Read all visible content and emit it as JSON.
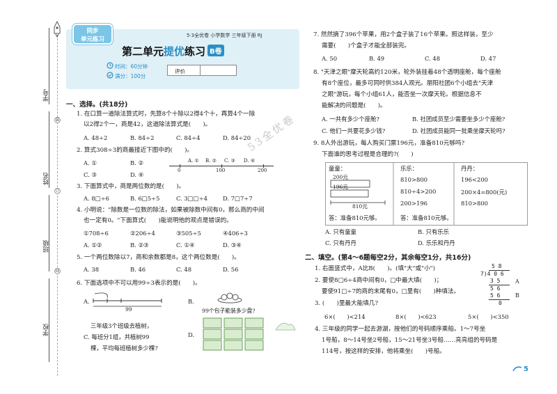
{
  "binding": {
    "labels": [
      "学号",
      "姓名",
      "班级",
      "学校"
    ],
    "hole_labels": [
      "装",
      "订",
      "线"
    ]
  },
  "header": {
    "badge_line1": "同步",
    "badge_line2": "单元练习",
    "book_info": "5·3全优卷  小学数学  三年级下册  RJ",
    "title_part1": "第二单元",
    "title_part2": "提优",
    "title_part3": "练习",
    "title_badge": "B卷",
    "time": "时间：60分钟",
    "full_score": "满分：100分",
    "score_label": "评价"
  },
  "watermark": "53全优卷",
  "section1": {
    "title": "一、选择。(共18分)",
    "q1": {
      "line1": "1. 在口算一道除法算式时，先算8个十除以2得4个十，再算4个一除",
      "line2": "以2得2个一，商是42，这道除法算式是(　　)。",
      "options": [
        "A. 48÷2",
        "B. 84÷2",
        "C. 84÷4",
        "D. 84÷20"
      ]
    },
    "q2": {
      "line1": "2. 算式308÷3的商最接近下图中的(　　)。",
      "options": [
        "A. ①",
        "B. ②",
        "C. ③",
        "D. ④"
      ],
      "numline_labels": [
        "0",
        "100",
        "200"
      ]
    },
    "q3": {
      "line1": "3. 下面算式中，商是两位数的是(　　)。",
      "options": [
        "A. 8□÷6",
        "B. 6□5÷5",
        "C. 3□□÷4",
        "D. 7□7÷7"
      ]
    },
    "q4": {
      "line1": "4. 小明说：\"除数是一位数的除法，如果被除数中间有0，那么商的中间",
      "line2": "也一定有0。\"下面算式(　　)能说明他的观点是错误的。",
      "options": [
        "①708÷6",
        "②206÷4",
        "③505÷5",
        "④406÷3"
      ],
      "choices": [
        "A. ①②",
        "B. ②③",
        "C. ①④",
        "D. ③④"
      ]
    },
    "q5": {
      "line1": "5. 一个两位数除以7，商和余数都是8，这个两位数是(　　)。",
      "options": [
        "A. 38",
        "B. 46",
        "C. 48",
        "D. 56"
      ]
    },
    "q6": {
      "line1": "6. 下面选项中不可以用99÷3表示的是(　　)。",
      "optA": "A.",
      "optA_label": "99",
      "optB": "B.",
      "optB_text": "99个包子能装多少盘?",
      "optC_1": "三年级3个班级去植树，",
      "optC_2": "C. 每班分1组，共植树99",
      "optC_3": "棵，平均每班植树多少棵?",
      "optD": "D."
    }
  },
  "right": {
    "q7": {
      "line1": "7. 然然摘了396个苹果，用2个盒子装了16个苹果。照这样装，至少",
      "line2": "需要(　　)个盒子才能全部装完。",
      "options": [
        "A. 50",
        "B. 49",
        "C. 48",
        "D. 47"
      ]
    },
    "q8": {
      "line1": "8. \"天津之眼\"摩天轮高约120米，轮外装挂着48个透明座舱，每个座舱",
      "line2": "有8个座位，最多可同时供384人观光。朋阳社团6个小组去\"天津",
      "line3": "之眼\"游玩，每个小组61人，能否坐一次摩天轮。根据信息不",
      "line4": "能解决的问题是(　　)。",
      "options": [
        "A. 一共有多少个座舱?",
        "B. 社团成员至少需要坐多少个座舱?",
        "C. 他们一共要花多少钱?",
        "D. 社团成员能同一批乘坐摩天轮吗?"
      ]
    },
    "q9": {
      "line1": "9. 8人外出游玩，每人购买门票196元，准备810元够吗?",
      "line2": "下面谁的思考过程是合理的?(　　)",
      "col1_title": "童童：",
      "col1_a": "200元",
      "col1_b": "196元",
      "col1_c": "810元",
      "col1_ans": "答：准备810元够。",
      "col2_title": "乐乐：",
      "col2_r1": "810>800",
      "col2_r2": "810÷4>200",
      "col2_r3": "200>196",
      "col2_ans": "答：准备810元够。",
      "col3_title": "丹丹：",
      "col3_r1": "196<200",
      "col3_r2": "200×4=800(元)",
      "col3_r3": "810>800",
      "options": [
        "A. 只有童童",
        "B. 只有乐乐",
        "C. 只有丹丹",
        "D. 乐乐和丹丹"
      ]
    },
    "section2": {
      "title": "二、填空。(第4～6题每空2分，其余每空1分，共16分)",
      "q1": "1. 右面竖式中，A比B(　　)。(填\"大\"或\"小\")",
      "q2_line1": "2. 要使8□6÷4商中间有0，□中最大填(　　)；",
      "q2_line2": "要使91□÷7的商的末尾有0，□里有(　　)种填法。",
      "q3_line1": "3. (　　)里最大能填几?",
      "q3_items": [
        "6×(　　)<214",
        "8×(　　)<623",
        "5×(　　)<350"
      ],
      "q4_line1": "4. 三年级的同学一起去游湖，按他们的号码顺序乘船。1～7号坐",
      "q4_line2": "1号船，8～14号坐2号船，15～21号坐3号船……亮亮组的号码是",
      "q4_line3": "114号，按这样的安排，他将乘坐(　　)号船。",
      "division": [
        "5 8",
        "7)4 0 6",
        "3 5",
        "5 6",
        "5 6",
        "0"
      ],
      "div_A": "A",
      "div_B": "B"
    }
  },
  "page_number": "5"
}
